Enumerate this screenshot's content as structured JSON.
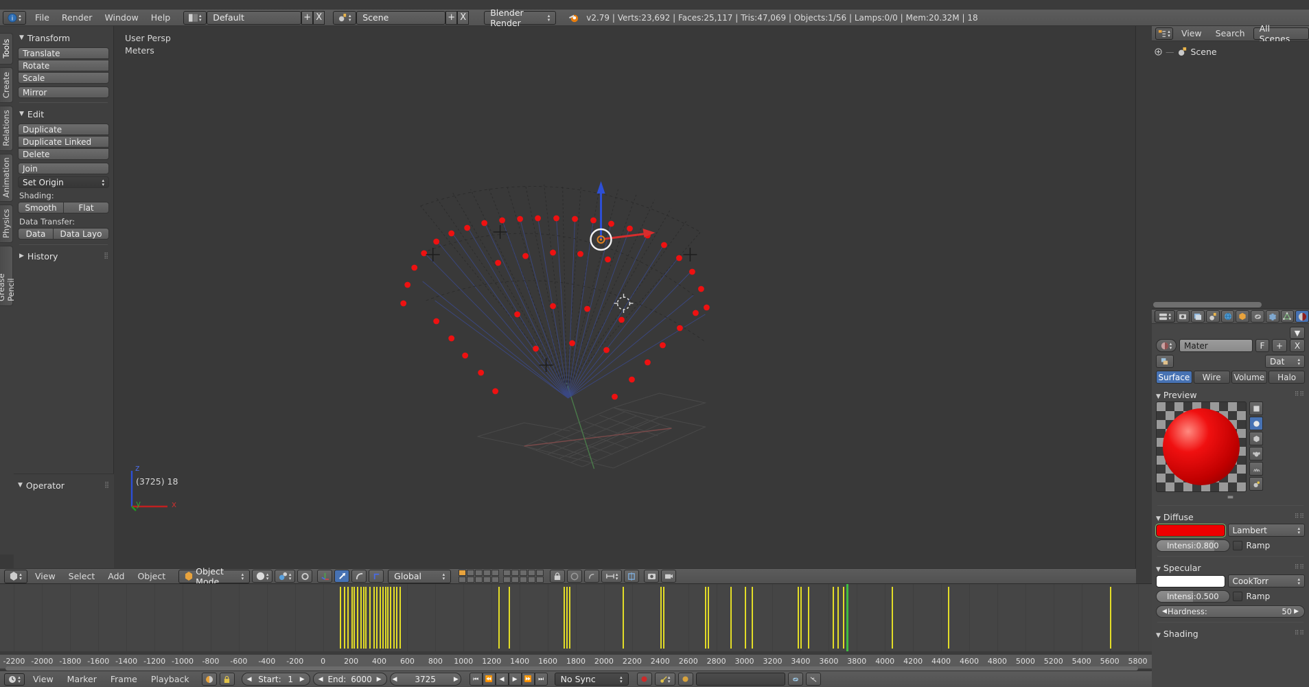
{
  "topbar": {
    "info_icon": "blender-info-icon",
    "menus": [
      "File",
      "Render",
      "Window",
      "Help"
    ],
    "screen_layout_icon": "screen-layout-icon",
    "screen_layout": "Default",
    "scene_icon": "scene-icon",
    "scene_name": "Scene",
    "add_label": "+",
    "remove_label": "X",
    "engine": "Blender Render",
    "blender_logo": "blender-logo-icon",
    "stats": "v2.79 | Verts:23,692 | Faces:25,117 | Tris:47,069 | Objects:1/56 | Lamps:0/0 | Mem:20.32M | 18"
  },
  "toolshelf": {
    "tabs": [
      "Tools",
      "Create",
      "Relations",
      "Animation",
      "Physics",
      "Grease Pencil"
    ],
    "active_tab": "Tools",
    "transform": {
      "title": "Transform",
      "buttons": [
        "Translate",
        "Rotate",
        "Scale",
        "Mirror"
      ]
    },
    "edit": {
      "title": "Edit",
      "buttons": [
        "Duplicate",
        "Duplicate Linked",
        "Delete",
        "Join"
      ],
      "set_origin": "Set Origin",
      "shading_label": "Shading:",
      "shading_buttons": [
        "Smooth",
        "Flat"
      ],
      "data_transfer_label": "Data Transfer:",
      "data_transfer_buttons": [
        "Data",
        "Data Layo"
      ]
    },
    "history": {
      "title": "History"
    },
    "operator_panel": {
      "title": "Operator"
    }
  },
  "viewport": {
    "persp_label": "User Persp",
    "units_label": "Meters",
    "frame_label": "(3725) 18",
    "axis_x": "x",
    "axis_y": "y",
    "axis_z": "z",
    "header": {
      "editor_icon": "3d-view-editor-icon",
      "menus": [
        "View",
        "Select",
        "Add",
        "Object"
      ],
      "mode_icon": "object-mode-icon",
      "mode": "Object Mode",
      "shading_icon": "solid-shading-icon",
      "pivot_icon": "pivot-point-icon",
      "snap_icon": "snap-magnet-icon",
      "manipulator_icons": [
        "translate-manipulator-icon",
        "rotate-manipulator-icon",
        "scale-manipulator-icon"
      ],
      "orientation": "Global",
      "layers_label": "scene-layers-grid",
      "lock_icon": "lock-icon",
      "proportional_icon": "proportional-edit-icon",
      "snap_during_icon": "snap-during-transform-icon",
      "render_icon": "render-preview-icon",
      "camera_icon": "camera-icon"
    }
  },
  "outliner": {
    "editor_icon": "outliner-editor-icon",
    "menus": [
      "View",
      "Search"
    ],
    "display_mode": "All Scenes",
    "tree": [
      {
        "expand_icon": "expand-plus-icon",
        "icon": "scene-icon",
        "label": "Scene"
      }
    ]
  },
  "properties": {
    "editor_icon": "properties-editor-icon",
    "tab_icons": [
      "render-tab-icon",
      "render-layers-tab-icon",
      "scene-tab-icon",
      "world-tab-icon",
      "object-tab-icon",
      "constraints-tab-icon",
      "modifiers-tab-icon",
      "data-tab-icon",
      "material-tab-icon"
    ],
    "active_tab": "material-tab-icon",
    "material_browse_icon": "material-browse-icon",
    "material_name": "Mater",
    "fake_user": "F",
    "new_material": "+",
    "unlink_material": "X",
    "copy_icon": "copy-material-icon",
    "datablock_label": "Dat",
    "type_tabs": [
      "Surface",
      "Wire",
      "Volume",
      "Halo"
    ],
    "type_tabs_selected": "Surface",
    "preview": {
      "title": "Preview",
      "buttons": [
        "flat-preview-icon",
        "sphere-preview-icon",
        "cube-preview-icon",
        "monkey-preview-icon",
        "hair-preview-icon",
        "sss-preview-icon"
      ],
      "selected": "sphere-preview-icon"
    },
    "diffuse": {
      "title": "Diffuse",
      "color": "#ef0000",
      "shader": "Lambert",
      "intensity_label": "Intensi:",
      "intensity_value": "0.800",
      "ramp_label": "Ramp"
    },
    "specular": {
      "title": "Specular",
      "color": "#ffffff",
      "shader": "CookTorr",
      "intensity_label": "Intensi:",
      "intensity_value": "0.500",
      "ramp_label": "Ramp",
      "hardness_label": "Hardness:",
      "hardness_value": "50"
    },
    "shading": {
      "title": "Shading"
    }
  },
  "timeline": {
    "editor_icon": "timeline-editor-icon",
    "menus": [
      "View",
      "Marker",
      "Frame",
      "Playback"
    ],
    "only_selected_icon": "only-selected-channels-icon",
    "lock_icon": "lock-time-icon",
    "start_label": "Start:",
    "start_value": "1",
    "end_label": "End:",
    "end_value": "6000",
    "current_frame": "3725",
    "nav_buttons": [
      "jump-to-start-icon",
      "prev-keyframe-icon",
      "play-reverse-icon",
      "play-icon",
      "next-keyframe-icon",
      "jump-to-end-icon"
    ],
    "sync_mode": "No Sync",
    "record_icon": "auto-keyframe-record-icon",
    "keying_icon": "keying-set-icon",
    "new_keying_icon": "new-keying-set-icon",
    "search_placeholder": "",
    "link_icon": "link-icon",
    "unlink_icon": "unlink-icon",
    "ruler_labels": [
      "-2200",
      "-2000",
      "-1800",
      "-1600",
      "-1400",
      "-1200",
      "-1000",
      "-800",
      "-600",
      "-400",
      "-200",
      "0",
      "200",
      "400",
      "600",
      "800",
      "1000",
      "1200",
      "1400",
      "1600",
      "1800",
      "2000",
      "2200",
      "2400",
      "2600",
      "2800",
      "3000",
      "3200",
      "3400",
      "3600",
      "3800",
      "4000",
      "4200",
      "4400",
      "4600",
      "4800",
      "5000",
      "5200",
      "5400",
      "5600",
      "5800"
    ],
    "ruler_min": -2300,
    "ruler_max": 5900,
    "playhead_frame": 3725,
    "keyframes": [
      120,
      150,
      175,
      200,
      215,
      240,
      265,
      285,
      300,
      330,
      360,
      380,
      400,
      420,
      440,
      455,
      475,
      500,
      520,
      545,
      1250,
      1320,
      1710,
      1730,
      1750,
      2130,
      2400,
      2420,
      2720,
      2740,
      2900,
      3000,
      3050,
      3380,
      3400,
      3450,
      3630,
      3660,
      3700,
      4050,
      4450,
      5600
    ]
  },
  "colors": {
    "accent": "#4772b3",
    "keyframe": "#e3dd27",
    "playhead": "#3fbf3f",
    "diffuse": "#ef0000",
    "vertex": "#ee1111"
  },
  "scene3d": {
    "pivot_label": "3d-cursor",
    "object_origin_label": "object-origin"
  }
}
